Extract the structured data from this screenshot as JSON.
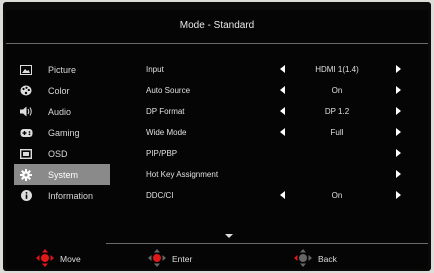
{
  "title": "Mode - Standard",
  "sidebar": {
    "items": [
      {
        "label": "Picture",
        "icon": "picture-icon"
      },
      {
        "label": "Color",
        "icon": "palette-icon"
      },
      {
        "label": "Audio",
        "icon": "speaker-icon"
      },
      {
        "label": "Gaming",
        "icon": "gamepad-icon"
      },
      {
        "label": "OSD",
        "icon": "osd-icon"
      },
      {
        "label": "System",
        "icon": "gear-icon",
        "active": true
      },
      {
        "label": "Information",
        "icon": "info-icon"
      }
    ]
  },
  "settings": [
    {
      "label": "Input",
      "value": "HDMI 1(1.4)",
      "left_arrow": true,
      "right_arrow": true
    },
    {
      "label": "Auto Source",
      "value": "On",
      "left_arrow": true,
      "right_arrow": true
    },
    {
      "label": "DP Format",
      "value": "DP 1.2",
      "left_arrow": true,
      "right_arrow": true
    },
    {
      "label": "Wide Mode",
      "value": "Full",
      "left_arrow": true,
      "right_arrow": true
    },
    {
      "label": "PIP/PBP",
      "value": "",
      "left_arrow": false,
      "right_arrow": true
    },
    {
      "label": "Hot Key Assignment",
      "value": "",
      "left_arrow": false,
      "right_arrow": true
    },
    {
      "label": "DDC/CI",
      "value": "On",
      "left_arrow": true,
      "right_arrow": true
    }
  ],
  "footer": {
    "move_label": "Move",
    "enter_label": "Enter",
    "back_label": "Back"
  },
  "colors": {
    "background": "#050505",
    "highlight": "#8a8a8a",
    "accent_red": "#e01818",
    "text": "#e0e0e0"
  }
}
